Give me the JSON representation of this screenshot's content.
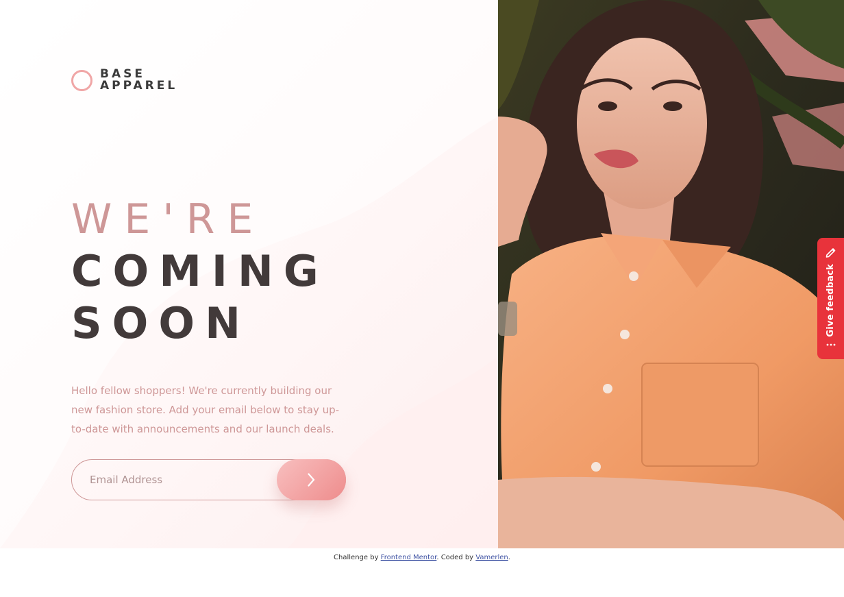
{
  "brand": {
    "line1": "BASE",
    "line2": "APPAREL"
  },
  "headline": {
    "line1": "We're",
    "line2": "coming",
    "line3": "soon"
  },
  "description": "Hello fellow shoppers! We're currently building our new fashion store. Add your email below to stay up-to-date with announcements and our launch deals.",
  "form": {
    "email_placeholder": "Email Address",
    "submit_icon": "chevron-right-icon"
  },
  "feedback": {
    "label": "Give feedback",
    "icon": "pencil-icon",
    "more_icon": "more-dots-icon"
  },
  "footer": {
    "prefix": "Challenge by ",
    "link1": "Frontend Mentor",
    "middle": ". Coded by ",
    "link2": "Vamerlen",
    "suffix": "."
  },
  "colors": {
    "accent": "#ce9797",
    "dark": "#423a3a",
    "button_from": "#f8bfbf",
    "button_to": "#ee8c8c",
    "feedback": "#e8333b",
    "shirt": "#f2a16f"
  }
}
